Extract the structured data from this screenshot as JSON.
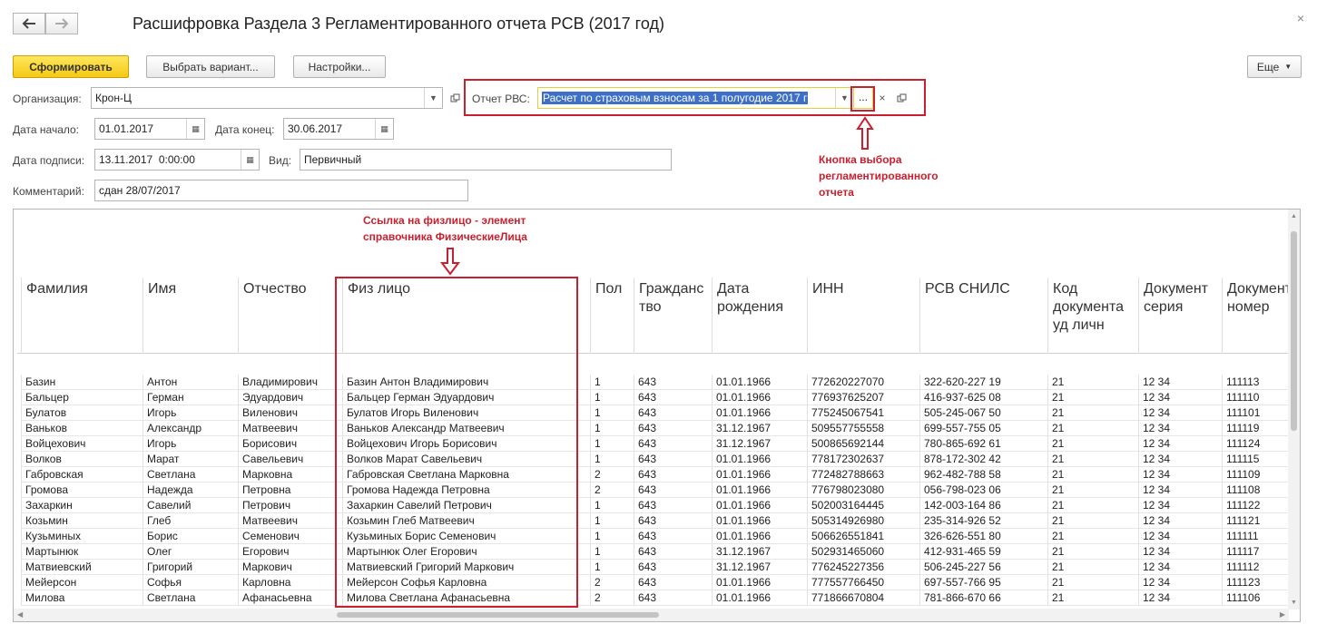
{
  "window": {
    "title": "Расшифровка Раздела 3 Регламентированного отчета РСВ (2017 год)",
    "close_glyph": "×"
  },
  "toolbar": {
    "generate_label": "Сформировать",
    "choose_variant_label": "Выбрать вариант...",
    "settings_label": "Настройки...",
    "more_label": "Еще"
  },
  "form": {
    "organization_label": "Организация:",
    "organization_value": "Крон-Ц",
    "report_label": "Отчет РВС:",
    "report_value": "Расчет по страховым взносам за 1 полугодие 2017 г",
    "report_pick_label": "...",
    "report_clear_label": "×",
    "date_start_label": "Дата начало:",
    "date_start_value": "01.01.2017",
    "date_end_label": "Дата конец:",
    "date_end_value": "30.06.2017",
    "sign_date_label": "Дата подписи:",
    "sign_date_value": "13.11.2017  0:00:00",
    "kind_label": "Вид:",
    "kind_value": "Первичный",
    "comment_label": "Комментарий:",
    "comment_value": "сдан 28/07/2017"
  },
  "annotations": {
    "pick_button_note": [
      "Кнопка выбора",
      "регламентированного",
      "отчета"
    ],
    "person_link_note": [
      "Ссылка на физлицо - элемент",
      "справочника ФизическиеЛица"
    ]
  },
  "table": {
    "headers": [
      [
        "Фамилия"
      ],
      [
        "Имя"
      ],
      [
        "Отчество"
      ],
      [
        "Физ лицо"
      ],
      [
        "Пол"
      ],
      [
        "Гражданс",
        "тво"
      ],
      [
        "Дата",
        "рождения"
      ],
      [
        "ИНН"
      ],
      [
        "РСВ СНИЛС"
      ],
      [
        "Код",
        "документа",
        "уд личн"
      ],
      [
        "Документ",
        "серия"
      ],
      [
        "Документ",
        "номер"
      ]
    ],
    "rows": [
      [
        "Базин",
        "Антон",
        "Владимирович",
        "Базин Антон Владимирович",
        "1",
        "643",
        "01.01.1966",
        "772620227070",
        "322-620-227 19",
        "21",
        "12 34",
        "111113"
      ],
      [
        "Бальцер",
        "Герман",
        "Эдуардович",
        "Бальцер Герман Эдуардович",
        "1",
        "643",
        "01.01.1966",
        "776937625207",
        "416-937-625 08",
        "21",
        "12 34",
        "111110"
      ],
      [
        "Булатов",
        "Игорь",
        "Виленович",
        "Булатов Игорь Виленович",
        "1",
        "643",
        "01.01.1966",
        "775245067541",
        "505-245-067 50",
        "21",
        "12 34",
        "111101"
      ],
      [
        "Ваньков",
        "Александр",
        "Матвеевич",
        "Ваньков Александр Матвеевич",
        "1",
        "643",
        "31.12.1967",
        "509557755558",
        "699-557-755 05",
        "21",
        "12 34",
        "111119"
      ],
      [
        "Войцехович",
        "Игорь",
        "Борисович",
        "Войцехович Игорь Борисович",
        "1",
        "643",
        "31.12.1967",
        "500865692144",
        "780-865-692 61",
        "21",
        "12 34",
        "111124"
      ],
      [
        "Волков",
        "Марат",
        "Савельевич",
        "Волков Марат Савельевич",
        "1",
        "643",
        "01.01.1966",
        "778172302637",
        "878-172-302 42",
        "21",
        "12 34",
        "111115"
      ],
      [
        "Габровская",
        "Светлана",
        "Марковна",
        "Габровская Светлана Марковна",
        "2",
        "643",
        "01.01.1966",
        "772482788663",
        "962-482-788 58",
        "21",
        "12 34",
        "111109"
      ],
      [
        "Громова",
        "Надежда",
        "Петровна",
        "Громова Надежда Петровна",
        "2",
        "643",
        "01.01.1966",
        "776798023080",
        "056-798-023 06",
        "21",
        "12 34",
        "111108"
      ],
      [
        "Захаркин",
        "Савелий",
        "Петрович",
        "Захаркин Савелий Петрович",
        "1",
        "643",
        "01.01.1966",
        "502003164445",
        "142-003-164 86",
        "21",
        "12 34",
        "111122"
      ],
      [
        "Козьмин",
        "Глеб",
        "Матвеевич",
        "Козьмин Глеб Матвеевич",
        "1",
        "643",
        "01.01.1966",
        "505314926980",
        "235-314-926 52",
        "21",
        "12 34",
        "111121"
      ],
      [
        "Кузьминых",
        "Борис",
        "Семенович",
        "Кузьминых Борис Семенович",
        "1",
        "643",
        "01.01.1966",
        "506626551841",
        "326-626-551 80",
        "21",
        "12 34",
        "111111"
      ],
      [
        "Мартынюк",
        "Олег",
        "Егорович",
        "Мартынюк Олег Егорович",
        "1",
        "643",
        "31.12.1967",
        "502931465060",
        "412-931-465 59",
        "21",
        "12 34",
        "111117"
      ],
      [
        "Матвиевский",
        "Григорий",
        "Маркович",
        "Матвиевский Григорий Маркович",
        "1",
        "643",
        "31.12.1967",
        "776245227356",
        "506-245-227 56",
        "21",
        "12 34",
        "111112"
      ],
      [
        "Мейерсон",
        "Софья",
        "Карловна",
        "Мейерсон Софья Карловна",
        "2",
        "643",
        "01.01.1966",
        "777557766450",
        "697-557-766 95",
        "21",
        "12 34",
        "111123"
      ],
      [
        "Милова",
        "Светлана",
        "Афанасьевна",
        "Милова Светлана Афанасьевна",
        "2",
        "643",
        "01.01.1966",
        "771866670804",
        "781-866-670 66",
        "21",
        "12 34",
        "111106"
      ]
    ]
  }
}
